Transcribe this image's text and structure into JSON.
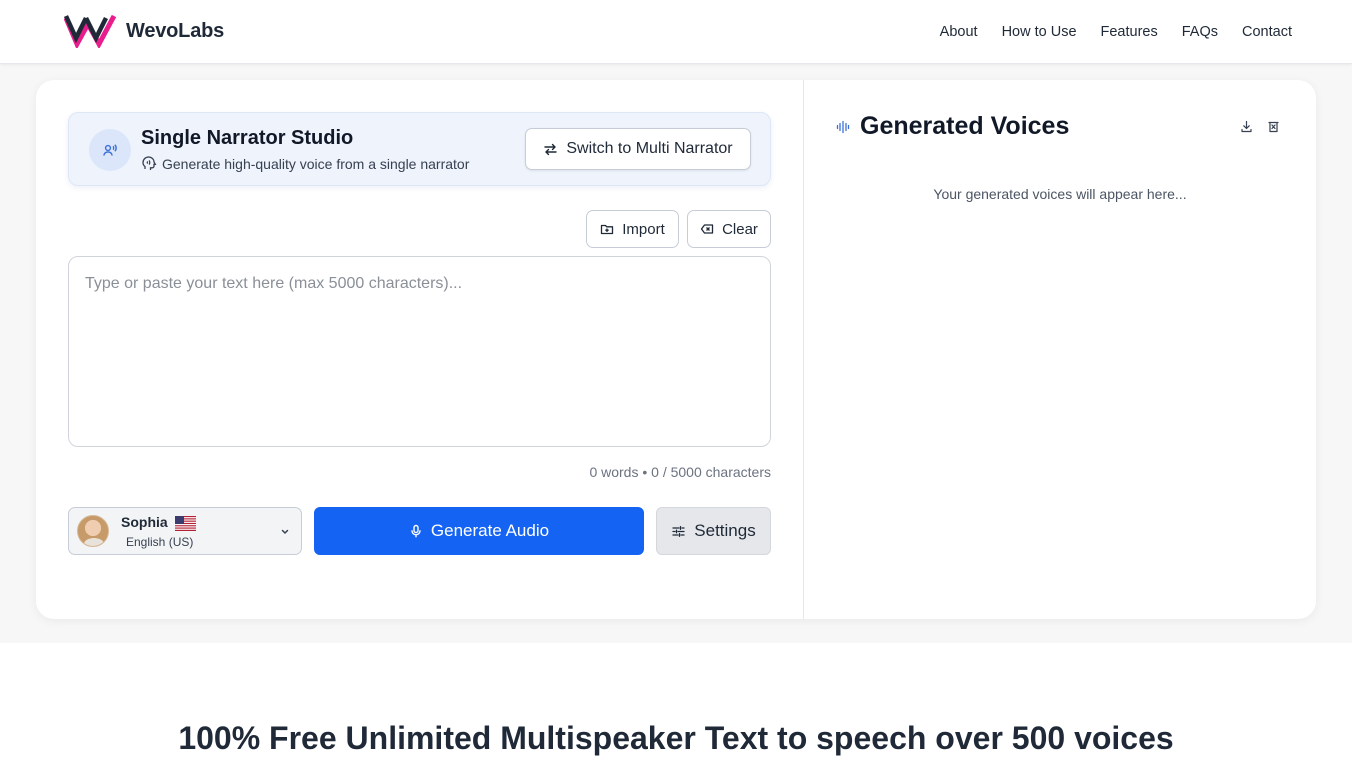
{
  "brand": {
    "name": "WevoLabs"
  },
  "nav": {
    "items": [
      {
        "label": "About"
      },
      {
        "label": "How to Use"
      },
      {
        "label": "Features"
      },
      {
        "label": "FAQs"
      },
      {
        "label": "Contact"
      }
    ]
  },
  "studio": {
    "title": "Single Narrator Studio",
    "subtitle": "Generate high-quality voice from a single narrator",
    "switch_label": "Switch to Multi Narrator"
  },
  "editor": {
    "import_label": "Import",
    "clear_label": "Clear",
    "placeholder": "Type or paste your text here (max 5000 characters)...",
    "value": "",
    "counter": "0 words • 0 / 5000 characters"
  },
  "voice": {
    "name": "Sophia",
    "language": "English (US)",
    "flag": "us-flag"
  },
  "actions": {
    "generate_label": "Generate Audio",
    "settings_label": "Settings"
  },
  "generated": {
    "title": "Generated Voices",
    "empty_message": "Your generated voices will appear here..."
  },
  "hero": {
    "headline": "100% Free Unlimited Multispeaker Text to speech over 500 voices"
  },
  "colors": {
    "primary": "#1463f3",
    "logo_pink": "#e91e8c",
    "studio_bg": "#eef3fc"
  }
}
